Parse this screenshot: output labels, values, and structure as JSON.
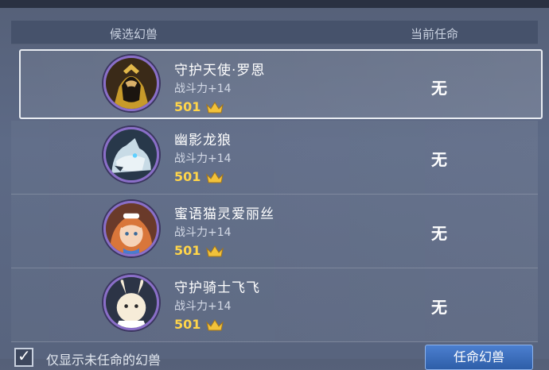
{
  "header": {
    "candidate_label": "候选幻兽",
    "current_task_label": "当前任命"
  },
  "rows": [
    {
      "name": "守护天使·罗恩",
      "power": "战斗力+14",
      "level": "501",
      "task": "无",
      "selected": true
    },
    {
      "name": "幽影龙狼",
      "power": "战斗力+14",
      "level": "501",
      "task": "无",
      "selected": false
    },
    {
      "name": "蜜语猫灵爱丽丝",
      "power": "战斗力+14",
      "level": "501",
      "task": "无",
      "selected": false
    },
    {
      "name": "守护骑士飞飞",
      "power": "战斗力+14",
      "level": "501",
      "task": "无",
      "selected": false
    }
  ],
  "footer": {
    "filter_label": "仅显示未任命的幻兽",
    "filter_checked": true,
    "assign_button": "任命幻兽"
  },
  "colors": {
    "accent": "#4b7fd0",
    "level": "#ffd54a",
    "avatar_ring": "#8a6ec8"
  },
  "icons": {
    "crown": "crown-icon",
    "checkmark": "checkmark-icon"
  }
}
